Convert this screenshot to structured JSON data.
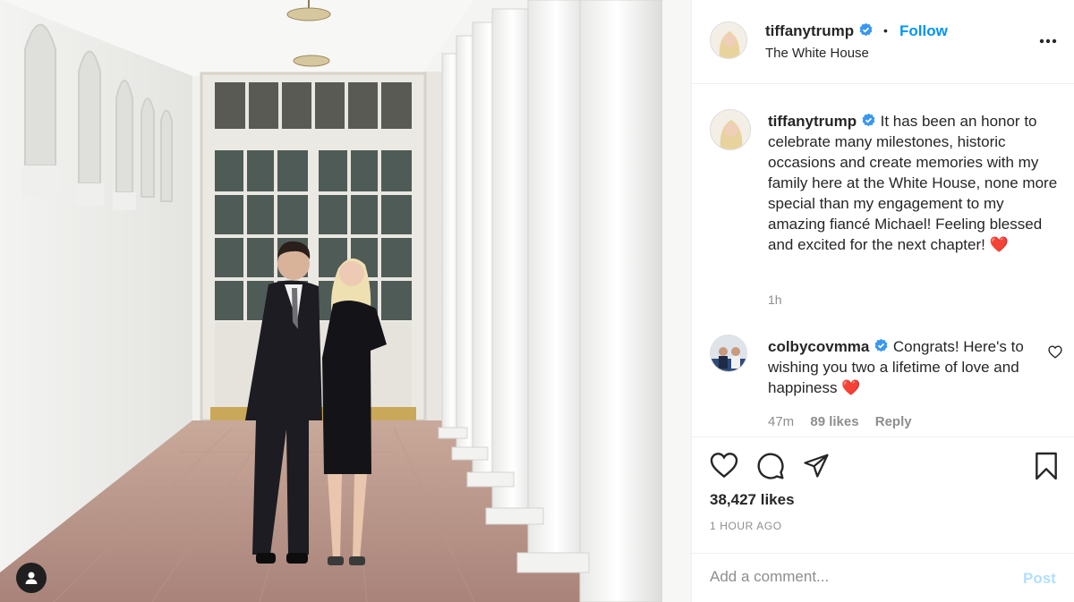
{
  "post": {
    "username": "tiffanytrump",
    "verified": true,
    "follow_label": "Follow",
    "separator": "•",
    "location": "The White House"
  },
  "caption": {
    "username": "tiffanytrump",
    "text": "It has been an honor to celebrate many milestones, historic occasions and create memories with my family here at the White House, none more special than my engagement to my amazing fiancé Michael! Feeling blessed and excited for the next chapter! ❤️",
    "time": "1h"
  },
  "comments": [
    {
      "username": "colbycovmma",
      "verified": true,
      "text": "Congrats! Here's to wishing you two a lifetime of love and happiness ❤️",
      "time": "47m",
      "likes": "89 likes",
      "reply_label": "Reply"
    }
  ],
  "engagement": {
    "likes": "38,427 likes",
    "timestamp": "1 HOUR AGO"
  },
  "add_comment": {
    "placeholder": "Add a comment...",
    "post_label": "Post"
  },
  "icons": {
    "more": "more-options-icon",
    "like": "heart-icon",
    "comment": "comment-icon",
    "share": "share-icon",
    "save": "bookmark-icon",
    "tag": "user-tag-icon",
    "verified": "verified-badge-icon"
  },
  "colors": {
    "accent": "#0095f6",
    "verified": "#3897f0",
    "muted": "#8e8e8e",
    "post_disabled": "#b2dffc",
    "heart_emoji": "#ed4956"
  }
}
